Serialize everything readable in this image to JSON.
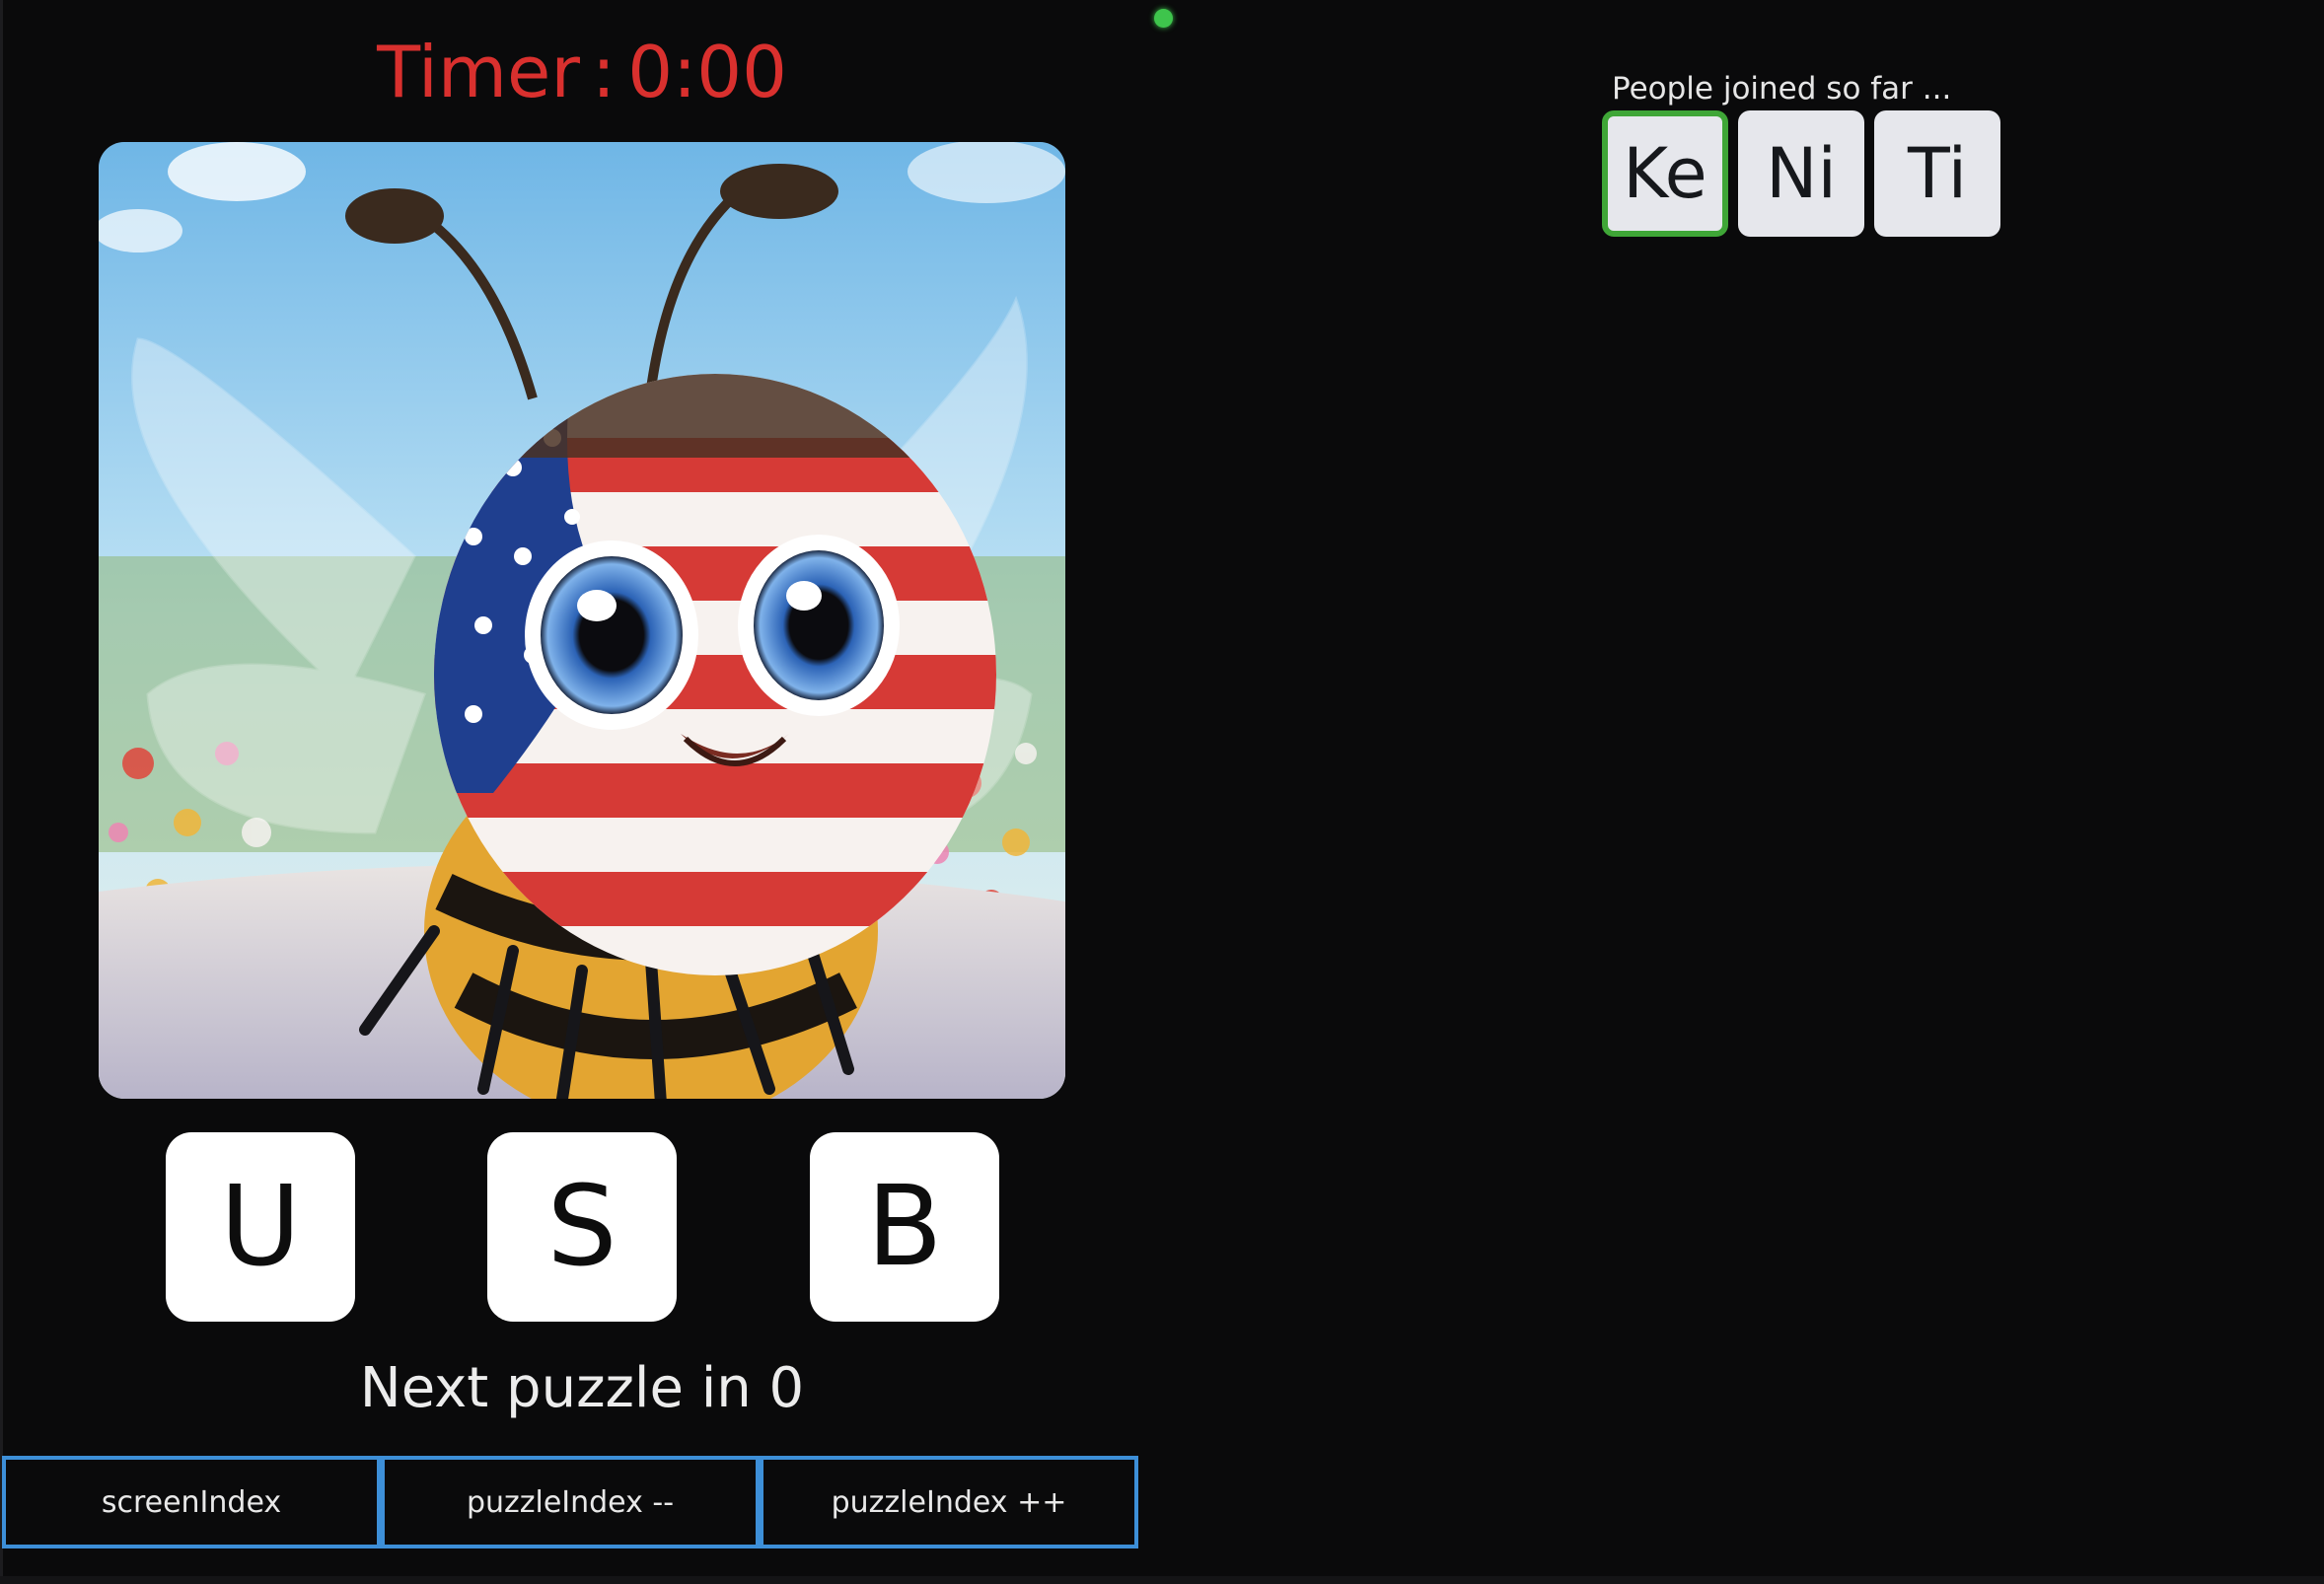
{
  "timer": {
    "label": "Timer",
    "separator": ":",
    "value": "0:00"
  },
  "puzzle": {
    "image": "Cartoon bee with American flag face",
    "letters": [
      "U",
      "S",
      "B"
    ]
  },
  "next_puzzle": {
    "text": "Next puzzle in 0"
  },
  "dev_buttons": [
    "screenIndex",
    "puzzleIndex --",
    "puzzleIndex ++"
  ],
  "people": {
    "label": "People joined so far ...",
    "members": [
      "Ke",
      "Ni",
      "Ti"
    ],
    "active_index": 0
  },
  "colors": {
    "background": "#0a0a0b",
    "timer": "#d9302e",
    "status_dot": "#3ec44c",
    "active_border": "#3fa637",
    "dev_button_border": "#3d8fd8"
  }
}
